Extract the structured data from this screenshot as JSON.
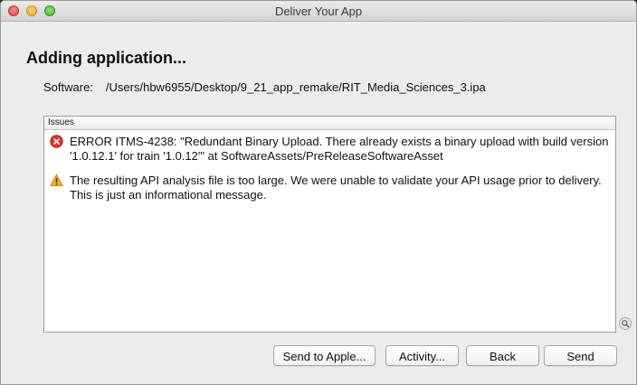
{
  "window": {
    "title": "Deliver Your App"
  },
  "heading": "Adding application...",
  "software": {
    "label": "Software:",
    "path": "/Users/hbw6955/Desktop/9_21_app_remake/RIT_Media_Sciences_3.ipa"
  },
  "issues": {
    "header": "Issues",
    "items": [
      {
        "severity": "error",
        "icon": "error-icon",
        "text": "ERROR ITMS-4238: \"Redundant Binary Upload. There already exists a binary upload with build version '1.0.12.1' for train '1.0.12'\" at SoftwareAssets/PreReleaseSoftwareAsset"
      },
      {
        "severity": "warning",
        "icon": "warning-icon",
        "text": "The resulting API analysis file is too large.  We were unable to validate your API usage prior to delivery.  This is just an informational message."
      }
    ]
  },
  "buttons": {
    "send_to_apple": "Send to Apple...",
    "activity": "Activity...",
    "back": "Back",
    "send": "Send"
  },
  "colors": {
    "error": "#d9342b",
    "warning": "#f2b319",
    "window_bg": "#ececec"
  }
}
